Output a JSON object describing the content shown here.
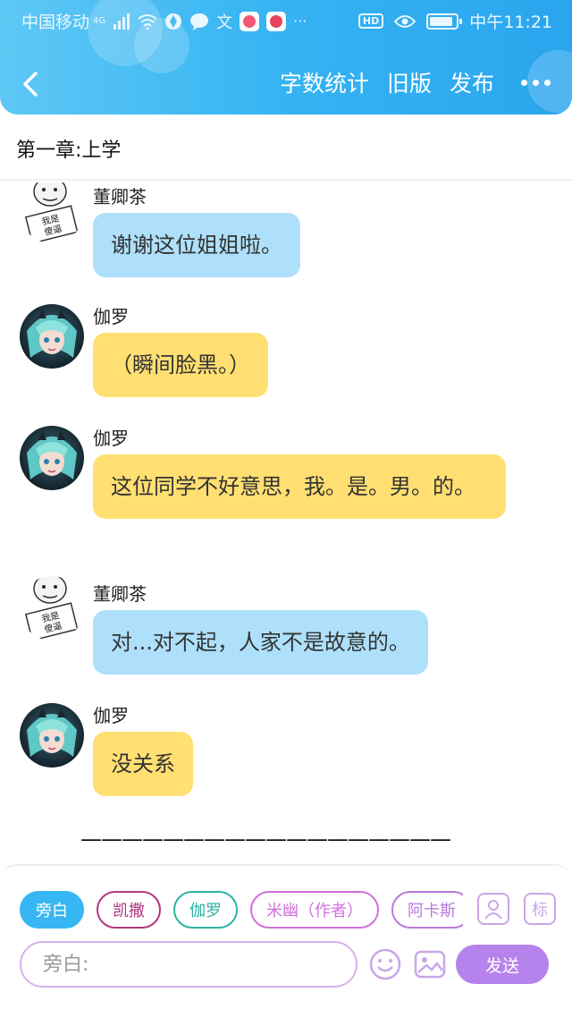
{
  "status_bar": {
    "carrier": "中国移动",
    "network": "4G",
    "time": "中午11:21",
    "hd": "HD",
    "battery_level": 0.9
  },
  "nav": {
    "actions": [
      "字数统计",
      "旧版",
      "发布"
    ]
  },
  "chapter": {
    "title": "第一章:上学"
  },
  "messages": [
    {
      "name": "董卿茶",
      "text": "谢谢这位姐姐啦。",
      "style": "blue",
      "avatar": "meme-avatar"
    },
    {
      "name": "伽罗",
      "text": "（瞬间脸黑。）",
      "style": "yellow",
      "avatar": "anime-girl-avatar"
    },
    {
      "name": "伽罗",
      "text": "这位同学不好意思，我。是。男。的。",
      "style": "yellow",
      "avatar": "anime-girl-avatar"
    },
    {
      "name": "董卿茶",
      "text": "对...对不起，人家不是故意的。",
      "style": "blue",
      "avatar": "meme-avatar"
    },
    {
      "name": "伽罗",
      "text": "没关系",
      "style": "yellow",
      "avatar": "anime-girl-avatar"
    }
  ],
  "meme_sign_text": "我是傻逼",
  "divider": "——————————————————",
  "characters": [
    {
      "label": "旁白",
      "color": "#36b6f2",
      "selected": true
    },
    {
      "label": "凯撒",
      "color": "#b0387e",
      "selected": false
    },
    {
      "label": "伽罗",
      "color": "#2bb3a3",
      "selected": false
    },
    {
      "label": "米幽（作者）",
      "color": "#d270dc",
      "selected": false
    },
    {
      "label": "阿卡斯",
      "color": "#b97ad9",
      "selected": false
    }
  ],
  "tools": {
    "mark_label": "标"
  },
  "composer": {
    "placeholder": "旁白:",
    "send_label": "发送"
  },
  "colors": {
    "header": "#35b3f2",
    "bubble_blue": "#aee0fb",
    "bubble_yellow": "#ffdf72",
    "send": "#b682eb"
  }
}
